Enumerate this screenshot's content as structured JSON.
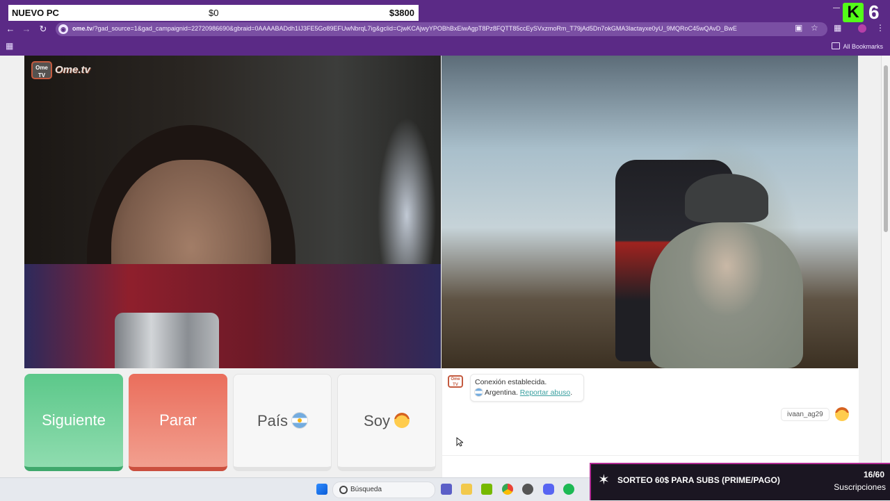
{
  "overlay": {
    "title": "NUEVO PC",
    "start": "$0",
    "goal": "$3800",
    "viewer_count": "6"
  },
  "browser": {
    "url_host": "ome.tv",
    "url_rest": "/?gad_source=1&gad_campaignid=22720986690&gbraid=0AAAABADdh1IJ3FE5Go89EFUwNbrqL7ig&gclid=CjwKCAjwyYPOBhBxEiwAgpT8Pz8FQTT85ccEySVxzmoRm_T79jAd5Dn7okGMA3lactayxe0yU_9MQRoC45wQAvD_BwE",
    "bookmarks_label": "All Bookmarks"
  },
  "site": {
    "logo_text": "Ome.tv",
    "logo_box": "Ome TV"
  },
  "buttons": {
    "next": "Siguiente",
    "stop": "Parar",
    "country": "País",
    "gender": "Soy"
  },
  "chat": {
    "system_line1": "Conexión establecida.",
    "system_country": "Argentina.",
    "report_link": "Reportar abuso",
    "report_suffix": ".",
    "username": "ivaan_ag29"
  },
  "taskbar": {
    "search_placeholder": "Búsqueda"
  },
  "giveaway": {
    "text": "SORTEO 60$ PARA SUBS (PRIME/PAGO)",
    "count": "16/60",
    "label": "Suscripciones"
  },
  "colors": {
    "next_green": "#5cc88a",
    "stop_red": "#ea6e5c",
    "browser_purple": "#5b2a86",
    "kick_green": "#53fc18"
  }
}
